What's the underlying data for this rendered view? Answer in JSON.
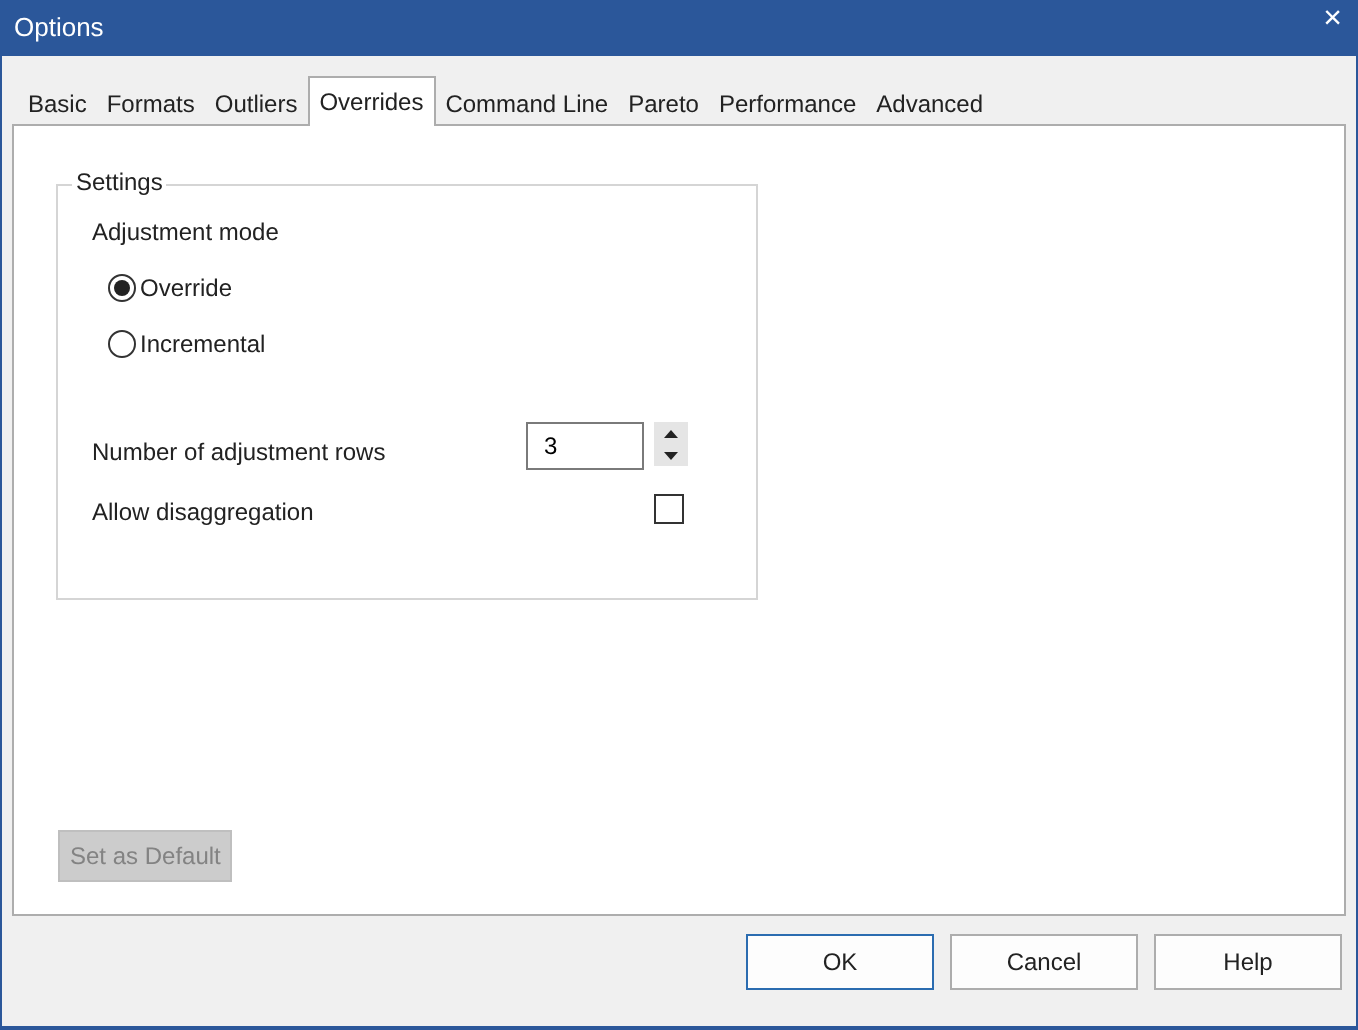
{
  "window": {
    "title": "Options",
    "close": "×"
  },
  "tabs": [
    {
      "label": "Basic",
      "selected": false
    },
    {
      "label": "Formats",
      "selected": false
    },
    {
      "label": "Outliers",
      "selected": false
    },
    {
      "label": "Overrides",
      "selected": true
    },
    {
      "label": "Command Line",
      "selected": false
    },
    {
      "label": "Pareto",
      "selected": false
    },
    {
      "label": "Performance",
      "selected": false
    },
    {
      "label": "Advanced",
      "selected": false
    }
  ],
  "settings": {
    "title": "Settings",
    "mode_label": "Adjustment mode",
    "modes": [
      {
        "label": "Override",
        "selected": true
      },
      {
        "label": "Incremental",
        "selected": false
      }
    ],
    "rows_label": "Number of adjustment rows",
    "rows_value": "3",
    "disaggregation_label": "Allow disaggregation",
    "disaggregation_checked": false
  },
  "default_button": {
    "label": "Set as Default",
    "disabled": true
  },
  "buttons": [
    {
      "label": "OK",
      "default": true
    },
    {
      "label": "Cancel",
      "default": false
    },
    {
      "label": "Help",
      "default": false
    }
  ]
}
